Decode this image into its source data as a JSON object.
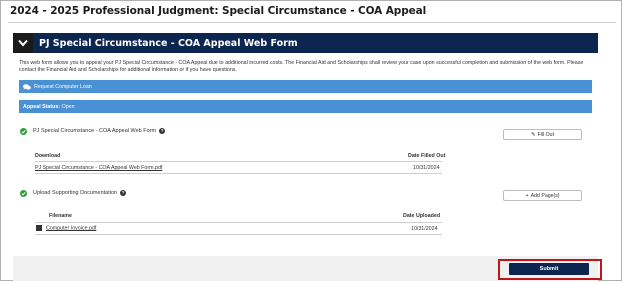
{
  "page": {
    "title": "2024 - 2025 Professional Judgment: Special Circumstance - COA Appeal"
  },
  "form_header": {
    "title": "PJ Special Circumstance - COA Appeal Web Form",
    "toggle_icon": "chevron-down-icon"
  },
  "intro": {
    "text": "This web form allows you to appeal your PJ Special Circumstance - COA Appeal due to additional incurred costs. The Financial Aid and Scholarships shall review your case upon successful completion and submission of the web form. Please contact the Financial Aid and Scholarships for additional information or if you have questions."
  },
  "loan_bar": {
    "label": "Request Computer Loan",
    "icon": "chat-icon",
    "color": "#4a90d4"
  },
  "status_bar": {
    "label": "Appeal Status:",
    "value": "Open"
  },
  "webform_section": {
    "label": "PJ Special Circumstance - COA Appeal Web Form",
    "button_label": "Fill Out",
    "button_icon": "edit-icon",
    "col_download": "Download",
    "col_date": "Date Filled Out",
    "rows": [
      {
        "file": "PJ Special Circumstance - COA Appeal Web Form.pdf",
        "date": "10/31/2024"
      }
    ]
  },
  "upload_section": {
    "label": "Upload Supporting Documentation",
    "button_label": "Add Page(s)",
    "button_icon": "plus-icon",
    "col_filename": "Filename",
    "col_date": "Date Uploaded",
    "rows": [
      {
        "file": "Computer Invoice.pdf",
        "date": "10/31/2024"
      }
    ]
  },
  "footer": {
    "submit_label": "Submit",
    "highlight_color": "#c0151a"
  }
}
